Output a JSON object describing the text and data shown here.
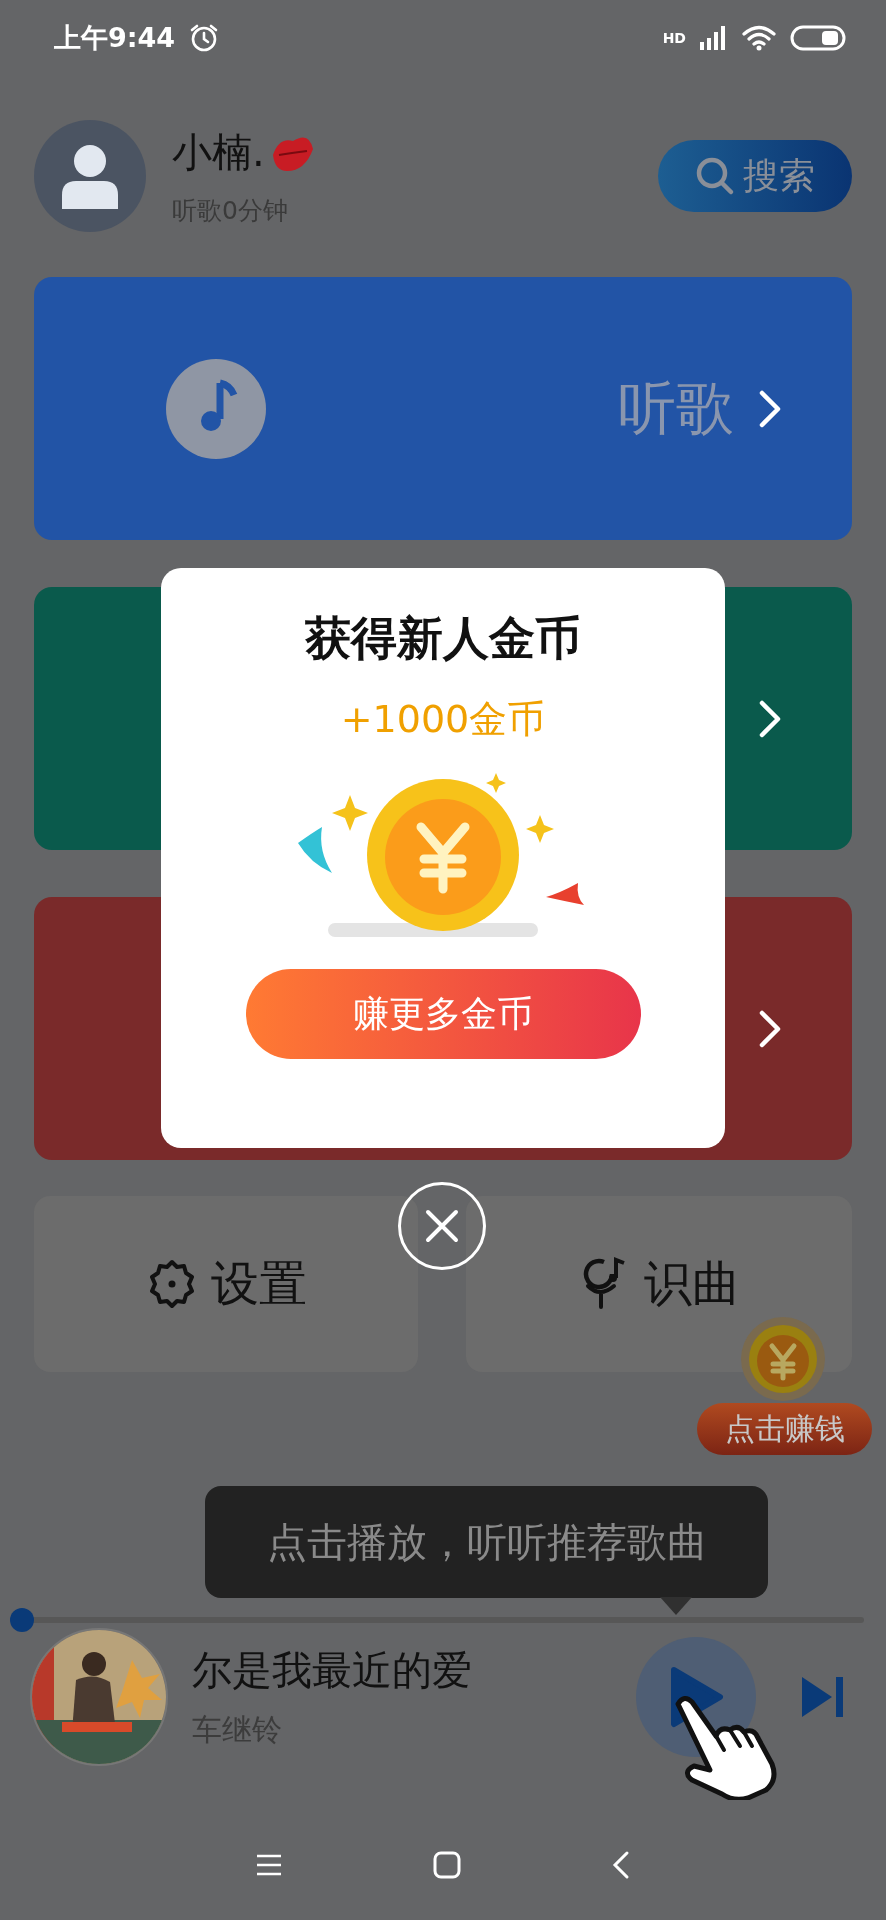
{
  "status_bar": {
    "time": "上午9:44",
    "network_label": "HD"
  },
  "profile": {
    "name": "小楠.",
    "subtitle": "听歌0分钟"
  },
  "search_button": {
    "label": "搜索"
  },
  "cards": [
    {
      "label": "听歌",
      "color": "#2254a6"
    },
    {
      "color": "#0a5a4c"
    },
    {
      "color": "#7a2a2a"
    }
  ],
  "tiles": [
    {
      "kind": "settings",
      "label": "设置"
    },
    {
      "kind": "recognize",
      "label": "识曲"
    }
  ],
  "earn_badge": {
    "label": "点击赚钱"
  },
  "tooltip": {
    "text": "点击播放，听听推荐歌曲"
  },
  "player": {
    "level": 0,
    "title": "尔是我最近的爱",
    "artist": "车继铃"
  },
  "dialog": {
    "title": "获得新人金币",
    "reward": "+1000金币",
    "button": "赚更多金币"
  }
}
